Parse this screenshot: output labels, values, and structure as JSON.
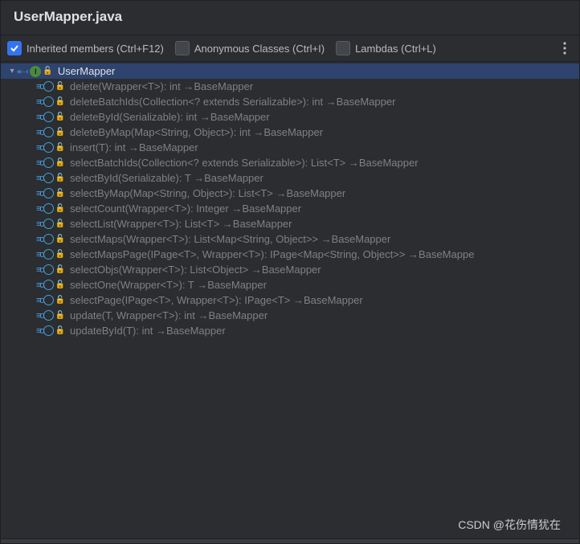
{
  "titlebar": {
    "title": "UserMapper.java"
  },
  "toolbar": {
    "inherited_label": "Inherited members (Ctrl+F12)",
    "anonymous_label": "Anonymous Classes (Ctrl+I)",
    "lambdas_label": "Lambdas (Ctrl+L)"
  },
  "tree": {
    "root": {
      "label": "UserMapper"
    },
    "children": [
      {
        "label": "delete(Wrapper<T>): int →BaseMapper"
      },
      {
        "label": "deleteBatchIds(Collection<? extends Serializable>): int →BaseMapper"
      },
      {
        "label": "deleteById(Serializable): int →BaseMapper"
      },
      {
        "label": "deleteByMap(Map<String, Object>): int →BaseMapper"
      },
      {
        "label": "insert(T): int →BaseMapper"
      },
      {
        "label": "selectBatchIds(Collection<? extends Serializable>): List<T> →BaseMapper"
      },
      {
        "label": "selectById(Serializable): T →BaseMapper"
      },
      {
        "label": "selectByMap(Map<String, Object>): List<T> →BaseMapper"
      },
      {
        "label": "selectCount(Wrapper<T>): Integer →BaseMapper"
      },
      {
        "label": "selectList(Wrapper<T>): List<T> →BaseMapper"
      },
      {
        "label": "selectMaps(Wrapper<T>): List<Map<String, Object>> →BaseMapper"
      },
      {
        "label": "selectMapsPage(IPage<T>, Wrapper<T>): IPage<Map<String, Object>> →BaseMappe"
      },
      {
        "label": "selectObjs(Wrapper<T>): List<Object> →BaseMapper"
      },
      {
        "label": "selectOne(Wrapper<T>): T →BaseMapper"
      },
      {
        "label": "selectPage(IPage<T>, Wrapper<T>): IPage<T> →BaseMapper"
      },
      {
        "label": "update(T, Wrapper<T>): int →BaseMapper"
      },
      {
        "label": "updateById(T): int →BaseMapper"
      }
    ]
  },
  "watermark": "CSDN @花伤情犹在"
}
